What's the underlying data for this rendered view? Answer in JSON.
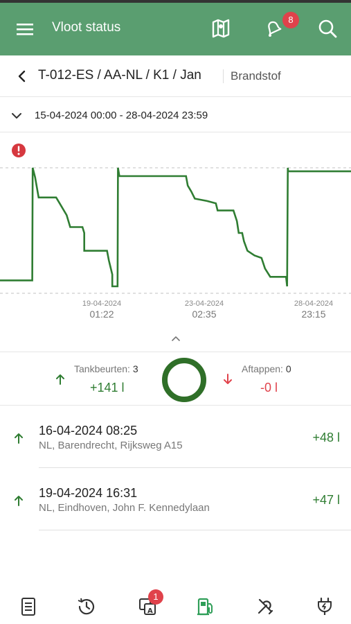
{
  "appbar": {
    "title": "Vloot status",
    "notification_count": "8",
    "icons": [
      "menu-icon",
      "map-icon",
      "bell-icon",
      "search-icon"
    ]
  },
  "crumb": {
    "path": "T-012-ES / AA-NL / K1 / Jan",
    "tab": "Brandstof"
  },
  "daterange": "15-04-2024 00:00 - 28-04-2024 23:59",
  "chart_data": {
    "type": "line",
    "series_color": "#2f7d32",
    "x_ticks": [
      {
        "date": "19-04-2024",
        "time": "01:22"
      },
      {
        "date": "23-04-2024",
        "time": "02:35"
      },
      {
        "date": "28-04-2024",
        "time": "23:15"
      }
    ],
    "grid": "dashed max/min reference lines",
    "points": [
      [
        0,
        0.05
      ],
      [
        0.092,
        0.05
      ],
      [
        0.093,
        1.0
      ],
      [
        0.1,
        0.92
      ],
      [
        0.11,
        0.75
      ],
      [
        0.16,
        0.75
      ],
      [
        0.17,
        0.7
      ],
      [
        0.19,
        0.6
      ],
      [
        0.2,
        0.5
      ],
      [
        0.235,
        0.5
      ],
      [
        0.24,
        0.45
      ],
      [
        0.24,
        0.3
      ],
      [
        0.305,
        0.3
      ],
      [
        0.31,
        0.22
      ],
      [
        0.32,
        0.1
      ],
      [
        0.32,
        0.0
      ],
      [
        0.335,
        0.0
      ],
      [
        0.336,
        1.0
      ],
      [
        0.34,
        0.93
      ],
      [
        0.345,
        0.93
      ],
      [
        0.53,
        0.93
      ],
      [
        0.535,
        0.85
      ],
      [
        0.545,
        0.8
      ],
      [
        0.555,
        0.74
      ],
      [
        0.59,
        0.72
      ],
      [
        0.615,
        0.7
      ],
      [
        0.62,
        0.64
      ],
      [
        0.665,
        0.64
      ],
      [
        0.675,
        0.55
      ],
      [
        0.68,
        0.45
      ],
      [
        0.69,
        0.45
      ],
      [
        0.695,
        0.38
      ],
      [
        0.705,
        0.3
      ],
      [
        0.725,
        0.26
      ],
      [
        0.745,
        0.24
      ],
      [
        0.755,
        0.15
      ],
      [
        0.77,
        0.08
      ],
      [
        0.815,
        0.08
      ],
      [
        0.818,
        0.0
      ],
      [
        0.82,
        0.97
      ],
      [
        0.82,
        1.0
      ],
      [
        0.821,
        0.97
      ],
      [
        1.0,
        0.97
      ]
    ]
  },
  "summary": {
    "refuels_label": "Tankbeurten:",
    "refuels_count": "3",
    "refuels_value": "+141 l",
    "drains_label": "Aftappen:",
    "drains_count": "0",
    "drains_value": "-0 l"
  },
  "list": [
    {
      "datetime": "16-04-2024 08:25",
      "location": "NL, Barendrecht, Rijksweg A15",
      "amount": "+48 l"
    },
    {
      "datetime": "19-04-2024 16:31",
      "location": "NL, Eindhoven, John F. Kennedylaan",
      "amount": "+47 l"
    }
  ],
  "bottomnav": {
    "badge_count": "1",
    "items": [
      "document-icon",
      "history-icon",
      "translate-icon",
      "fuel-icon",
      "tools-icon",
      "ev-charge-icon"
    ],
    "active_color": "#2f9e58"
  }
}
